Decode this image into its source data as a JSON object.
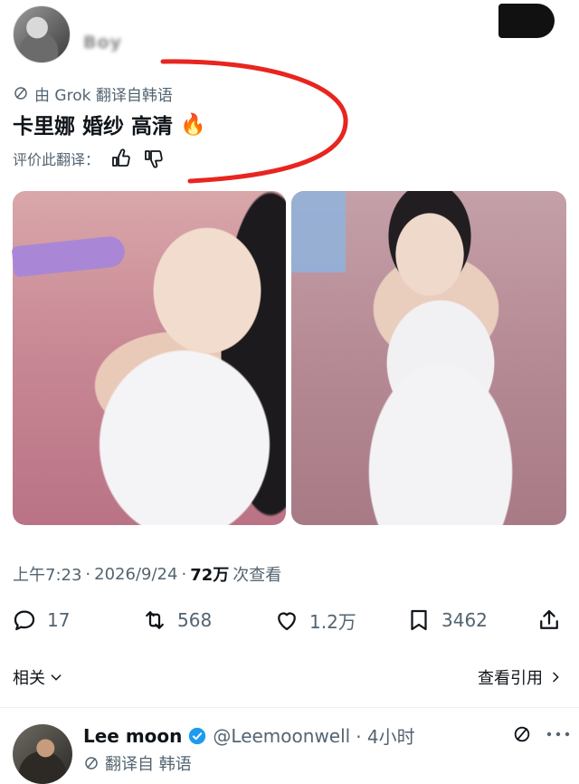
{
  "author": {
    "name_obscured": "Boy"
  },
  "translation": {
    "label": "由 Grok 翻译自韩语",
    "rate_label": "评价此翻译："
  },
  "tweet": {
    "text": "卡里娜 婚纱 高清",
    "emoji": "🔥"
  },
  "meta": {
    "time": "上午7:23",
    "date": "2026/9/24",
    "views_count": "72万",
    "views_label": "次查看"
  },
  "actions": {
    "replies": "17",
    "retweets": "568",
    "likes": "1.2万",
    "bookmarks": "3462"
  },
  "footer": {
    "related_label": "相关",
    "view_quotes_label": "查看引用"
  },
  "reply": {
    "name": "Lee moon",
    "handle": "@Leemoonwell",
    "time": "· 4小时",
    "translate_label": "翻译自 韩语"
  },
  "colors": {
    "annotation": "#e8251f",
    "secondary_text": "#536471",
    "primary_text": "#0f1419",
    "verified": "#1d9bf0"
  }
}
